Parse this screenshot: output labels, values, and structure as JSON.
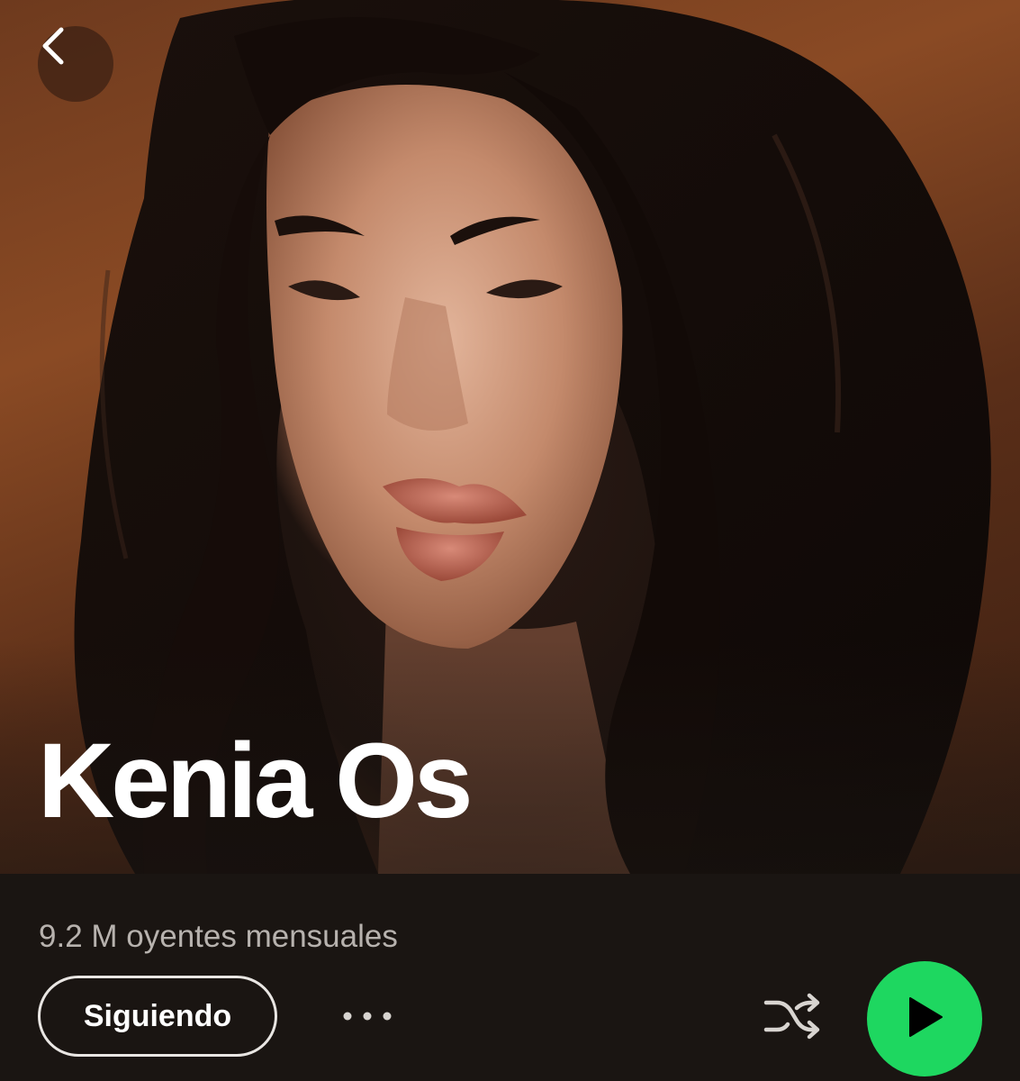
{
  "artist": {
    "name": "Kenia Os",
    "monthly_listeners": "9.2 M oyentes mensuales"
  },
  "actions": {
    "follow_label": "Siguiendo",
    "more_icon": "more-horizontal-icon",
    "shuffle_icon": "shuffle-icon",
    "play_icon": "play-icon",
    "back_icon": "chevron-left-icon"
  },
  "colors": {
    "accent": "#1ed760",
    "background": "#1a1512",
    "text_primary": "#ffffff",
    "text_secondary": "#b7b2ae"
  }
}
